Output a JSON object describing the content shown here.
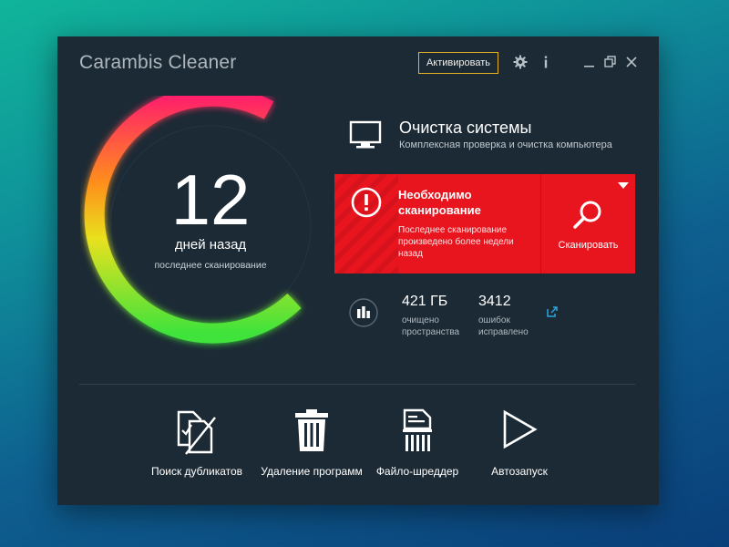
{
  "window": {
    "title": "Carambis Cleaner",
    "activate_label": "Активировать",
    "icons": [
      "gear-icon",
      "info-icon",
      "minimize-icon",
      "restore-icon",
      "close-icon"
    ]
  },
  "gauge": {
    "days_since_scan": "12",
    "days_label": "дней назад",
    "last_scan_label": "последнее сканирование",
    "colors": [
      "#ff1f6b",
      "#ff8a1f",
      "#f5e020",
      "#3fe33b"
    ]
  },
  "system": {
    "title": "Очистка системы",
    "subtitle": "Комплексная проверка и очистка компьютера"
  },
  "alert": {
    "title": "Необходимо сканирование",
    "text": "Последнее сканирование произведено более недели назад",
    "scan_label": "Сканировать",
    "color": "#e8141e"
  },
  "stats": {
    "space_value": "421 ГБ",
    "space_label": "очищено пространства",
    "errors_value": "3412",
    "errors_label": "ошибок исправлено"
  },
  "tools": [
    {
      "label": "Поиск дубликатов",
      "icon": "duplicates-icon"
    },
    {
      "label": "Удаление программ",
      "icon": "trash-icon"
    },
    {
      "label": "Файло-шреддер",
      "icon": "shredder-icon"
    },
    {
      "label": "Автозапуск",
      "icon": "play-icon"
    }
  ]
}
